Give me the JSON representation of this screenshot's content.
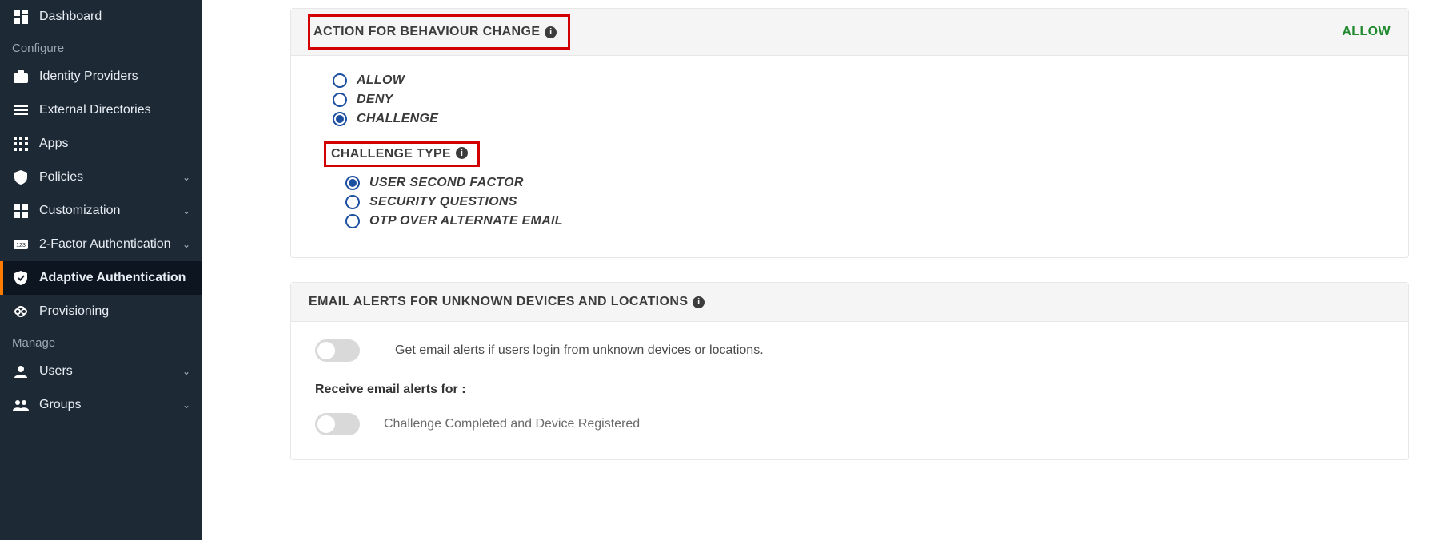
{
  "sidebar": {
    "sections": [
      {
        "type": "item",
        "key": "dashboard",
        "label": "Dashboard"
      },
      {
        "type": "heading",
        "key": "configure",
        "label": "Configure"
      },
      {
        "type": "item",
        "key": "idp",
        "label": "Identity Providers"
      },
      {
        "type": "item",
        "key": "extdir",
        "label": "External Directories"
      },
      {
        "type": "item",
        "key": "apps",
        "label": "Apps"
      },
      {
        "type": "item",
        "key": "policies",
        "label": "Policies",
        "expandable": true
      },
      {
        "type": "item",
        "key": "customization",
        "label": "Customization",
        "expandable": true
      },
      {
        "type": "item",
        "key": "twofa",
        "label": "2-Factor Authentication",
        "expandable": true
      },
      {
        "type": "item",
        "key": "adaptive",
        "label": "Adaptive Authentication",
        "active": true
      },
      {
        "type": "item",
        "key": "provisioning",
        "label": "Provisioning"
      },
      {
        "type": "heading",
        "key": "manage",
        "label": "Manage"
      },
      {
        "type": "item",
        "key": "users",
        "label": "Users",
        "expandable": true
      },
      {
        "type": "item",
        "key": "groups",
        "label": "Groups",
        "expandable": true
      }
    ]
  },
  "card1": {
    "title": "ACTION FOR BEHAVIOUR CHANGE",
    "chip": "ALLOW",
    "options": {
      "allow": "ALLOW",
      "deny": "DENY",
      "challenge": "CHALLENGE"
    },
    "challenge_title": "CHALLENGE TYPE",
    "challenge_options": {
      "usf": "USER SECOND FACTOR",
      "sq": "SECURITY QUESTIONS",
      "otp": "OTP OVER ALTERNATE EMAIL"
    }
  },
  "card2": {
    "title": "EMAIL ALERTS FOR UNKNOWN DEVICES AND LOCATIONS",
    "toggle_text": "Get email alerts if users login from unknown devices or locations.",
    "receive_title": "Receive email alerts for :",
    "opt1": "Challenge Completed and Device Registered"
  }
}
